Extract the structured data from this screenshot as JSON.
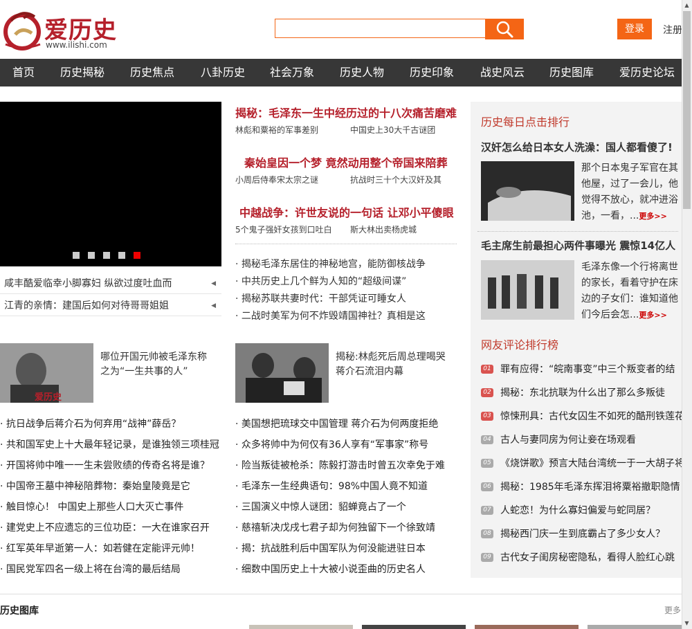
{
  "header": {
    "logo_text": "爱历史",
    "logo_url": "www.ilishi.com",
    "search_placeholder": "",
    "login_label": "登录",
    "register_label": "注册"
  },
  "nav": [
    "首页",
    "历史揭秘",
    "历史焦点",
    "八卦历史",
    "社会万象",
    "历史人物",
    "历史印象",
    "战史风云",
    "历史图库",
    "爱历史论坛"
  ],
  "slider": {
    "dots": 5,
    "active_dot": 5,
    "side_items": [
      "咸丰酷爱临幸小脚寡妇 纵欲过度吐血而",
      "江青的亲情：建国后如何对待哥哥姐姐"
    ]
  },
  "headlines": [
    {
      "title": "揭秘：毛泽东一生中经历过的十八次痛苦磨难",
      "sub1": "林彪和粟裕的军事差别",
      "sub2": "中国史上30大千古谜团"
    },
    {
      "title": "秦始皇因一个梦 竟然动用整个帝国来陪葬",
      "sub1": "小周后侍奉宋太宗之谜",
      "sub2": "抗战时三十个大汉奸及其"
    },
    {
      "title": "中越战争：许世友说的一句话 让邓小平傻眼",
      "sub1": "5个鬼子强奸女孩到口吐白",
      "sub2": "斯大林出卖杨虎城"
    }
  ],
  "bullet_list": [
    "揭秘毛泽东居住的神秘地宫，能防御核战争",
    "中共历史上几个鲜为人知的“超级间谍”",
    "揭秘苏联共妻时代：干部凭证可睡女人",
    "二战时美军为何不炸毁靖国神社？真相是这"
  ],
  "photo_blocks": [
    {
      "caption": "哪位开国元帅被毛泽东称之为“一生共事的人”",
      "watermark": "爱历史"
    },
    {
      "caption": "揭秘:林彪死后周总理喝哭蒋介石流泪内幕"
    }
  ],
  "list_left": [
    "抗日战争后蒋介石为何弃用“战神”薛岳？",
    "共和国军史上十大最年轻记录，是谁独领三项桂冠",
    "开国将帅中唯一一生未尝败绩的传奇名将是谁？",
    "中国帝王墓中神秘陪葬物：秦始皇陵竟是它",
    "触目惊心！ 中国史上那些人口大灭亡事件",
    "建党史上不应遗忘的三位功臣：一大在谁家召开",
    "红军英年早逝第一人：如若健在定能评元帅！",
    "国民党军四名一级上将在台湾的最后结局"
  ],
  "list_right": [
    "美国想把琉球交中国管理 蒋介石为何两度拒绝",
    "众多将帅中为何仅有36人享有“军事家”称号",
    "险当叛徒被枪杀：陈毅打游击时曾五次幸免于难",
    "毛泽东一生经典语句：98%中国人竟不知道",
    "三国演义中惊人谜团：貂蝉竟占了一个",
    "慈禧斩决戊戌七君子却为何独留下一个徐致靖",
    "揭：抗战胜利后中国军队为何没能进驻日本",
    "细数中国历史上十大被小说歪曲的历史名人"
  ],
  "right_panel": {
    "title1": "历史每日点击排行",
    "item1": {
      "head": "汉奸怎么给日本女人洗澡：国人都看傻了!",
      "text": "那个日本鬼子军官在其他屋，过了一会儿，他觉得不放心，就冲进浴池，一看，...",
      "more": "更多>>"
    },
    "item2": {
      "head": "毛主席生前最担心两件事曝光 震惊14亿人",
      "text": "毛泽东像一个行将离世的家长，看着守护在床边的子女们：谁知道他们今后会怎...",
      "more": "更多>>"
    },
    "title2": "网友评论排行榜",
    "ranks": [
      {
        "n": "01",
        "t": "罪有应得：“皖南事变”中三个叛变者的结"
      },
      {
        "n": "02",
        "t": "揭秘：东北抗联为什么出了那么多叛徒"
      },
      {
        "n": "03",
        "t": "惊悚刑具：古代女囚生不如死的酷刑铁莲花"
      },
      {
        "n": "04",
        "t": "古人与妻同房为何让妾在场观看"
      },
      {
        "n": "05",
        "t": "《烧饼歌》预言大陆台湾统一于一大胡子将"
      },
      {
        "n": "06",
        "t": "揭秘：1985年毛泽东挥泪将粟裕撤职隐情"
      },
      {
        "n": "07",
        "t": "人蛇恋！为什么寡妇偏爱与蛇同居？"
      },
      {
        "n": "08",
        "t": "揭秘西门庆一生到底霸占了多少女人？"
      },
      {
        "n": "09",
        "t": "古代女子闺房秘密隐私，看得人脸红心跳"
      }
    ]
  },
  "bottom": {
    "title": "历史图库",
    "more": "更多"
  },
  "colors": {
    "accent": "#f46515",
    "nav_bg": "#373737",
    "headline": "#b5202b",
    "rank_red": "#d9534f",
    "rank_gray": "#aaaaaa",
    "panel_bg": "#f3f3f3"
  }
}
